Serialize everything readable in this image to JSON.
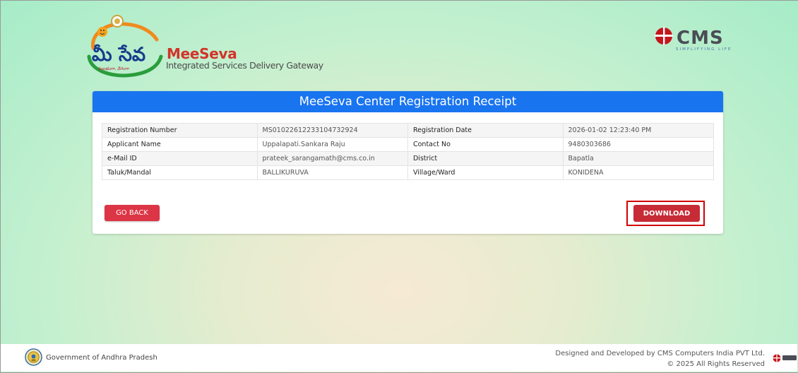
{
  "header": {
    "logo_telugu": "మీ సేవ",
    "logo_telugu_sub": "సులభంగా, వేగంగా",
    "brand_name": "MeeSeva",
    "brand_subtitle": "Integrated Services Delivery Gateway",
    "cms_name": "CMS",
    "cms_tagline": "SIMPLIFYING LIFE"
  },
  "receipt": {
    "title": "MeeSeva Center Registration Receipt",
    "rows": [
      {
        "label1": "Registration Number",
        "value1": "MS01022612233104732924",
        "label2": "Registration Date",
        "value2": "2026-01-02 12:23:40 PM"
      },
      {
        "label1": "Applicant Name",
        "value1": "Uppalapati.Sankara Raju",
        "label2": "Contact No",
        "value2": "9480303686"
      },
      {
        "label1": "e-Mail ID",
        "value1": "prateek_sarangamath@cms.co.in",
        "label2": "District",
        "value2": "Bapatla"
      },
      {
        "label1": "Taluk/Mandal",
        "value1": "BALLIKURUVA",
        "label2": "Village/Ward",
        "value2": "KONIDENA"
      }
    ],
    "go_back_label": "GO BACK",
    "download_label": "DOWNLOAD"
  },
  "footer": {
    "gov_text": "Government of Andhra Pradesh",
    "credit_line1": "Designed and Developed by CMS Computers India PVT Ltd.",
    "credit_line2": "© 2025 All Rights Reserved"
  },
  "colors": {
    "header_blue": "#1974f0",
    "go_back_red": "#dc3545",
    "download_red": "#c62b36",
    "highlight_outline": "#d10000",
    "brand_red": "#d2342a"
  }
}
